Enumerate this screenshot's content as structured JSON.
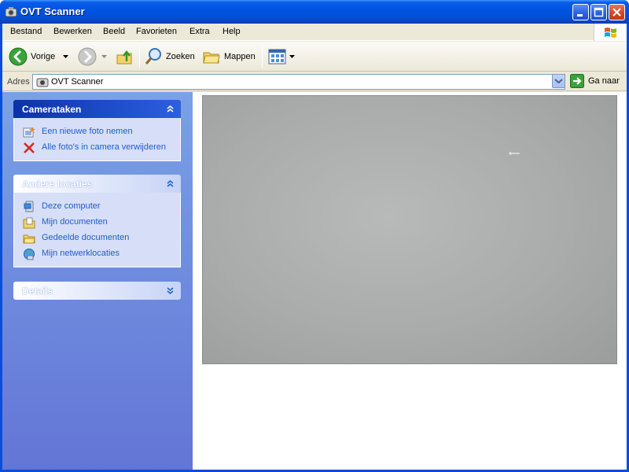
{
  "window": {
    "title": "OVT Scanner"
  },
  "menu": {
    "items": [
      "Bestand",
      "Bewerken",
      "Beeld",
      "Favorieten",
      "Extra",
      "Help"
    ]
  },
  "toolbar": {
    "back_label": "Vorige",
    "search_label": "Zoeken",
    "folders_label": "Mappen"
  },
  "address": {
    "label": "Adres",
    "value": "OVT Scanner",
    "go_label": "Ga naar"
  },
  "taskpane": {
    "camera": {
      "title": "Camerataken",
      "items": [
        {
          "label": "Een nieuwe foto nemen",
          "icon": "camera-icon"
        },
        {
          "label": "Alle foto's in camera verwijderen",
          "icon": "delete-icon"
        }
      ]
    },
    "other": {
      "title": "Andere locaties",
      "items": [
        {
          "label": "Deze computer",
          "icon": "computer-icon"
        },
        {
          "label": "Mijn documenten",
          "icon": "documents-icon"
        },
        {
          "label": "Gedeelde documenten",
          "icon": "folder-icon"
        },
        {
          "label": "Mijn netwerklocaties",
          "icon": "network-icon"
        }
      ]
    },
    "details": {
      "title": "Details"
    }
  },
  "colors": {
    "titlebar": "#0054e3",
    "taskpane": "#6f8ee0",
    "link": "#215dc6"
  }
}
